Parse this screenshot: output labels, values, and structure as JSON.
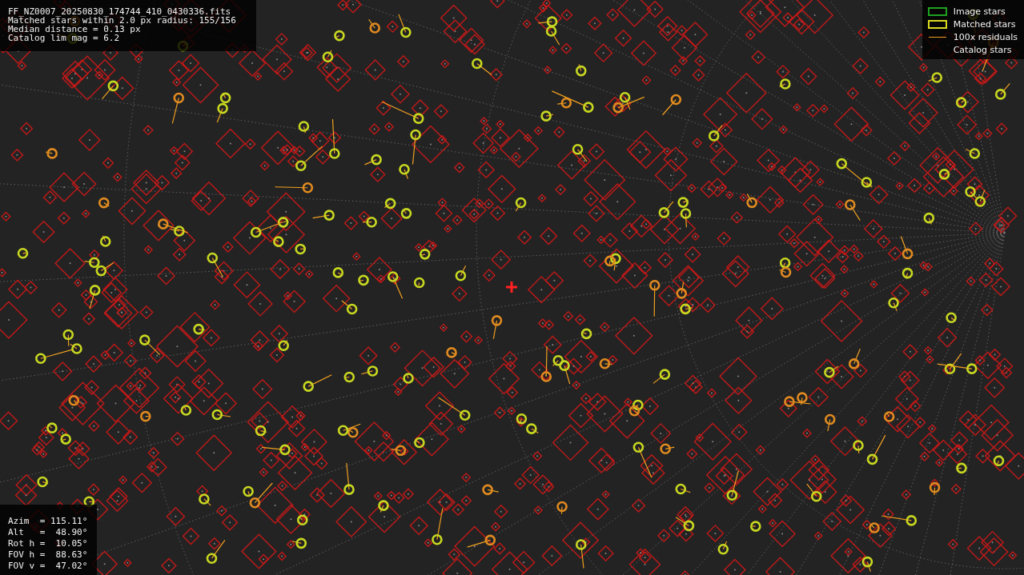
{
  "info": {
    "lines": [
      "FF_NZ0007_20250830_174744_410_0430336.fits",
      "Matched stars within 2.0 px radius: 155/156",
      "Median distance = 0.13 px",
      "Catalog lim mag = 6.2"
    ]
  },
  "legend": [
    {
      "kind": "image",
      "label": "Image stars"
    },
    {
      "kind": "matched",
      "label": "Matched stars"
    },
    {
      "kind": "residual",
      "label": "100x residuals"
    },
    {
      "kind": "catalog",
      "label": "Catalog stars"
    }
  ],
  "pointing": [
    "Azim  = 115.11°",
    "Alt   =  48.90°",
    "Rot h =  10.05°",
    "FOV h =  88.63°",
    "FOV v =  47.02°"
  ]
}
